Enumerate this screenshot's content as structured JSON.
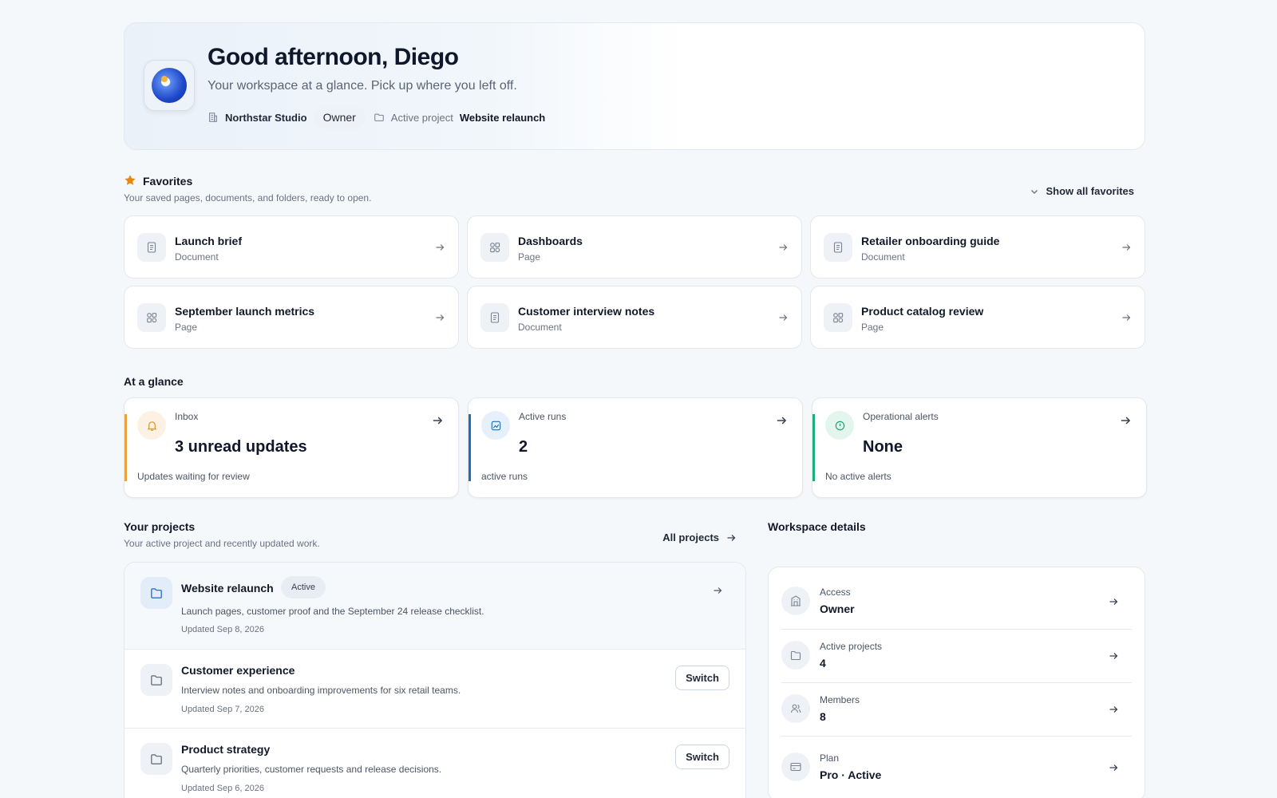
{
  "header": {
    "greeting": "Good afternoon, Diego",
    "subtitle": "Your workspace at a glance. Pick up where you left off.",
    "org_name": "Northstar Studio",
    "role": "Owner",
    "active_project_label": "Active project",
    "active_project": "Website relaunch"
  },
  "favorites": {
    "title": "Favorites",
    "subtitle": "Your saved pages, documents, and folders, ready to open.",
    "show_all": "Show all favorites",
    "items": [
      {
        "name": "Launch brief",
        "kind": "Document",
        "icon": "document-icon"
      },
      {
        "name": "Dashboards",
        "kind": "Page",
        "icon": "page-grid-icon"
      },
      {
        "name": "Retailer onboarding guide",
        "kind": "Document",
        "icon": "document-icon"
      },
      {
        "name": "September launch metrics",
        "kind": "Page",
        "icon": "page-grid-icon"
      },
      {
        "name": "Customer interview notes",
        "kind": "Document",
        "icon": "document-icon"
      },
      {
        "name": "Product catalog review",
        "kind": "Page",
        "icon": "page-grid-icon"
      }
    ]
  },
  "glance": {
    "title": "At a glance",
    "cards": [
      {
        "label": "Inbox",
        "value": "3 unread updates",
        "note": "Updates waiting for review",
        "icon": "bell-icon",
        "accent": "#e9a23b",
        "icon_bg": "#fdf1e3"
      },
      {
        "label": "Active runs",
        "value": "2",
        "note": "active runs",
        "icon": "chart-icon",
        "accent": "#1f6fb8",
        "icon_bg": "#e6f0fa"
      },
      {
        "label": "Operational alerts",
        "value": "None",
        "note": "No active alerts",
        "icon": "alert-circle-icon",
        "accent": "#1fae7a",
        "icon_bg": "#e3f6ee"
      }
    ]
  },
  "projects": {
    "title": "Your projects",
    "subtitle": "Your active project and recently updated work.",
    "all_link": "All projects",
    "items": [
      {
        "name": "Website relaunch",
        "badge": "Active",
        "desc": "Launch pages, customer proof and the September 24 release checklist.",
        "updated": "Updated Sep 8, 2026",
        "active": true
      },
      {
        "name": "Customer experience",
        "desc": "Interview notes and onboarding improvements for six retail teams.",
        "updated": "Updated Sep 7, 2026",
        "action": "Switch"
      },
      {
        "name": "Product strategy",
        "desc": "Quarterly priorities, customer requests and release decisions.",
        "updated": "Updated Sep 6, 2026",
        "action": "Switch"
      }
    ]
  },
  "workspace": {
    "title": "Workspace details",
    "rows": [
      {
        "label": "Access",
        "value": "Owner",
        "icon": "building-icon"
      },
      {
        "label": "Active projects",
        "value": "4",
        "icon": "folder-icon"
      },
      {
        "label": "Members",
        "value": "8",
        "icon": "users-icon"
      },
      {
        "label": "Plan",
        "value": "Pro · Active",
        "icon": "credit-card-icon"
      }
    ]
  },
  "colors": {
    "background": "#f5f8fb",
    "favorite_star": "#e8870f",
    "active_project_icon": "#2b6fd1"
  }
}
